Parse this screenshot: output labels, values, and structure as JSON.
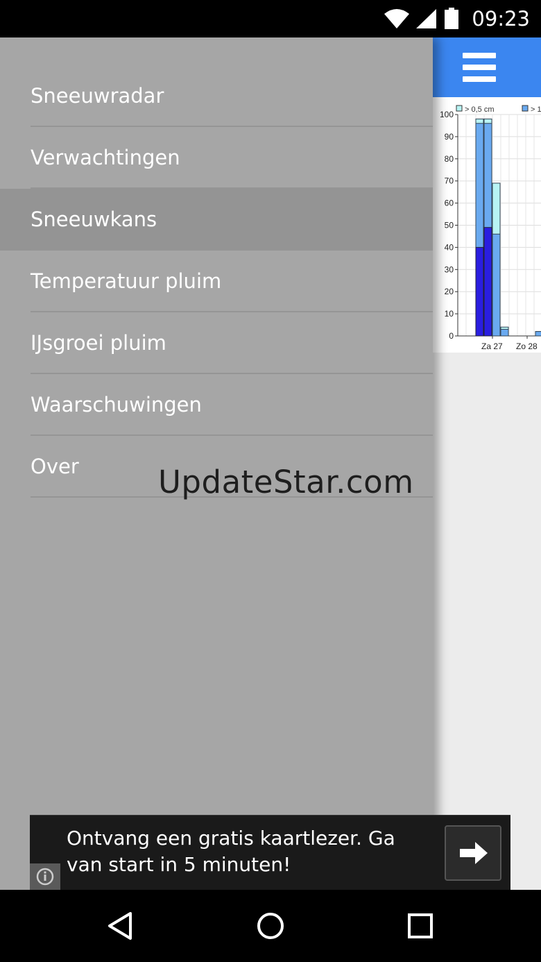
{
  "status_bar": {
    "time": "09:23",
    "icons": [
      "wifi-icon",
      "cell-signal-icon",
      "battery-icon"
    ]
  },
  "app_bar": {
    "menu_icon": "hamburger-menu-icon",
    "color": "#3b86f0"
  },
  "drawer": {
    "items": [
      {
        "label": "Sneeuwradar",
        "active": false
      },
      {
        "label": "Verwachtingen",
        "active": false
      },
      {
        "label": "Sneeuwkans",
        "active": true
      },
      {
        "label": "Temperatuur pluim",
        "active": false
      },
      {
        "label": "IJsgroei pluim",
        "active": false
      },
      {
        "label": "Waarschuwingen",
        "active": false
      },
      {
        "label": "Over",
        "active": false
      }
    ]
  },
  "watermark": "UpdateStar.com",
  "chart_data": {
    "type": "bar",
    "legend": [
      "> 0,5 cm",
      "> 1"
    ],
    "y_ticks": [
      "100",
      "90",
      "80",
      "70",
      "60",
      "50",
      "40",
      "30",
      "20",
      "10",
      "0"
    ],
    "ylim": [
      0,
      100
    ],
    "categories": [
      "Za 27",
      "Zo 28"
    ],
    "series": [
      {
        "name": "> 0,5 cm",
        "values": [
          98,
          98,
          69,
          4,
          2
        ]
      },
      {
        "name": "> 1",
        "values": [
          96,
          96,
          46,
          3,
          2
        ]
      }
    ],
    "dark_values": [
      40,
      49
    ],
    "colors": {
      "light": "#b8f4f4",
      "mid": "#6aaaf0",
      "dark": "#2a1ee0"
    }
  },
  "ad": {
    "text": "Ontvang een gratis kaartlezer. Ga van start in 5 minuten!",
    "info_icon": "info-icon",
    "arrow_icon": "arrow-right-icon"
  },
  "nav_bar": {
    "icons": [
      "back-icon",
      "home-icon",
      "recents-icon"
    ]
  }
}
